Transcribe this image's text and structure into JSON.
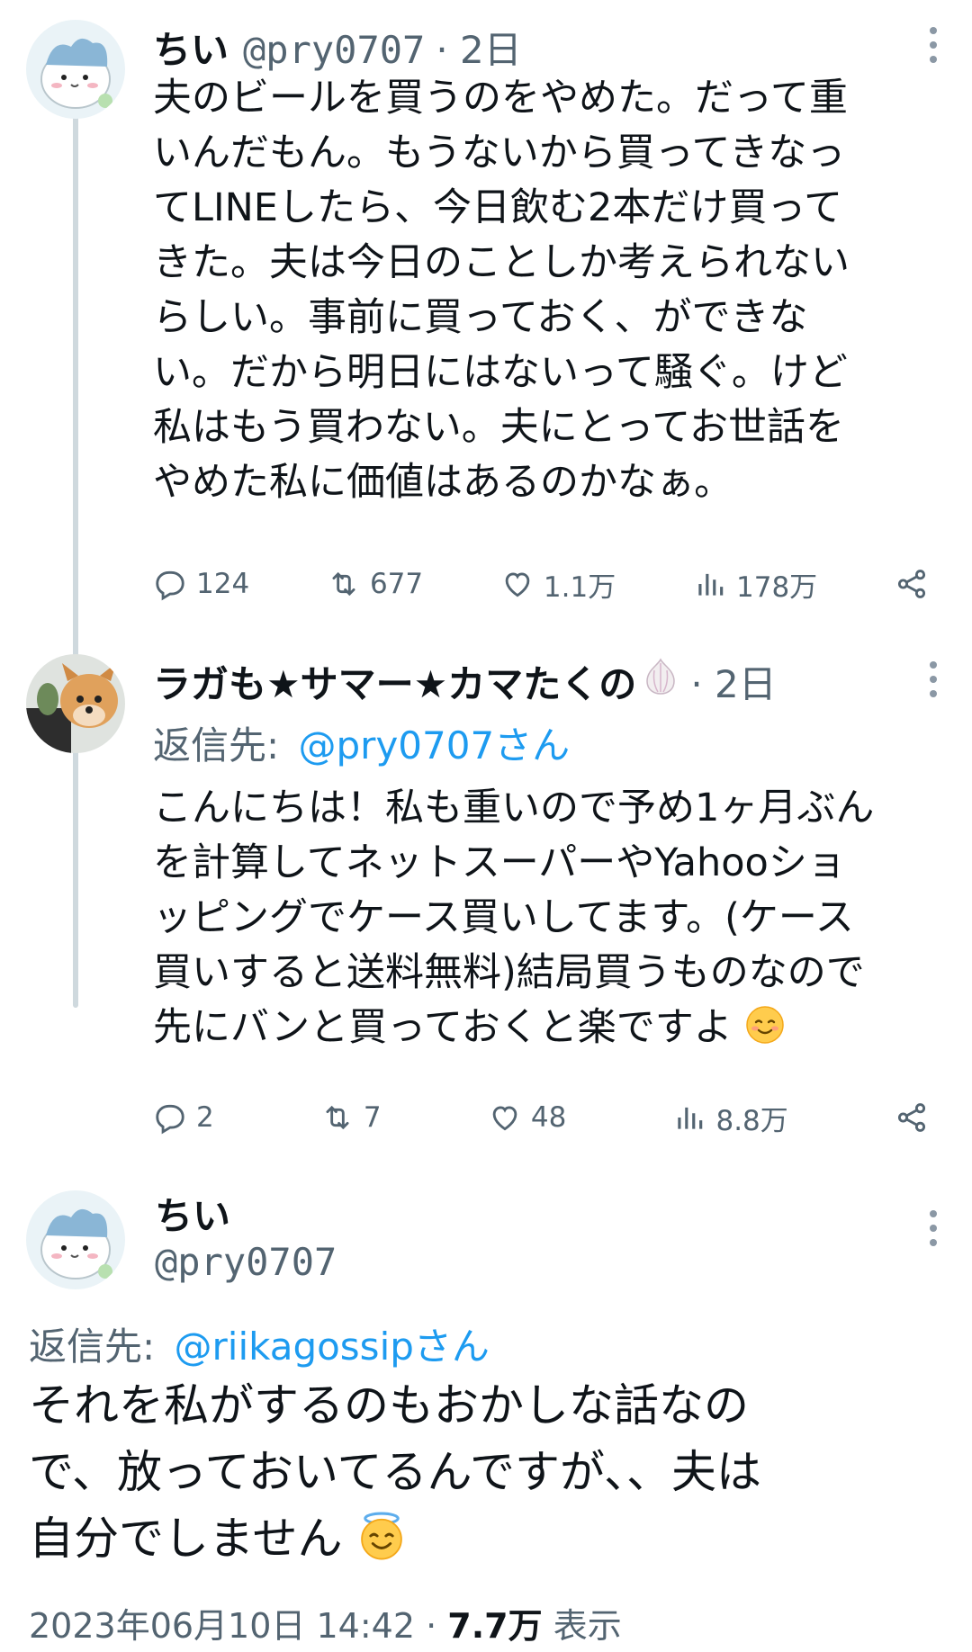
{
  "thread": [
    {
      "name": "ちい",
      "handle": "@pry0707",
      "time": "· 2日",
      "avatar": "hamster-character-avatar",
      "lines": [
        "夫のビールを買うのをやめた。だって重",
        "いんだもん。もうないから買ってきなっ",
        "てLINEしたら、今日飲む2本だけ買って",
        "きた。夫は今日のことしか考えられない",
        "らしい。事前に買っておく、ができな",
        "い。だから明日にはないって騒ぐ。けど",
        "私はもう買わない。夫にとってお世話を",
        "やめた私に価値はあるのかなぁ。"
      ],
      "replies": "124",
      "retweets": "677",
      "likes": "1.1万",
      "views": "178万"
    },
    {
      "name": "ラガも★サマー★カマたくの",
      "name_emoji": "garlic",
      "time": "· 2日",
      "avatar": "pomeranian-dog-avatar",
      "reply_to_prefix": "返信先:",
      "reply_to_handle": "@pry0707さん",
      "lines": [
        "こんにちは！私も重いので予め1ヶ月ぶん",
        "を計算してネットスーパーやYahooショ",
        "ッピングでケース買いしてます。(ケース",
        "買いすると送料無料)結局買うものなので",
        "先にバンと買っておくと楽ですよ"
      ],
      "trailing_emoji": "smiling-face",
      "replies": "2",
      "retweets": "7",
      "likes": "48",
      "views": "8.8万"
    }
  ],
  "main_post": {
    "name": "ちい",
    "handle": "@pry0707",
    "avatar": "hamster-character-avatar",
    "reply_to_prefix": "返信先:",
    "reply_to_handle": "@riikagossipさん",
    "lines": [
      "それを私がするのもおかしな話なの",
      "で、放っておいてるんですが、、夫は",
      "自分でしません"
    ],
    "trailing_emoji": "smiling-face-with-halo",
    "timestamp": "2023年06月10日 14:42 ·",
    "view_count": "7.7万",
    "view_label": "表示"
  },
  "colors": {
    "text": "#0f1419",
    "secondary": "#536471",
    "link": "#1d9bf0",
    "thread_line": "#cfd9de"
  }
}
